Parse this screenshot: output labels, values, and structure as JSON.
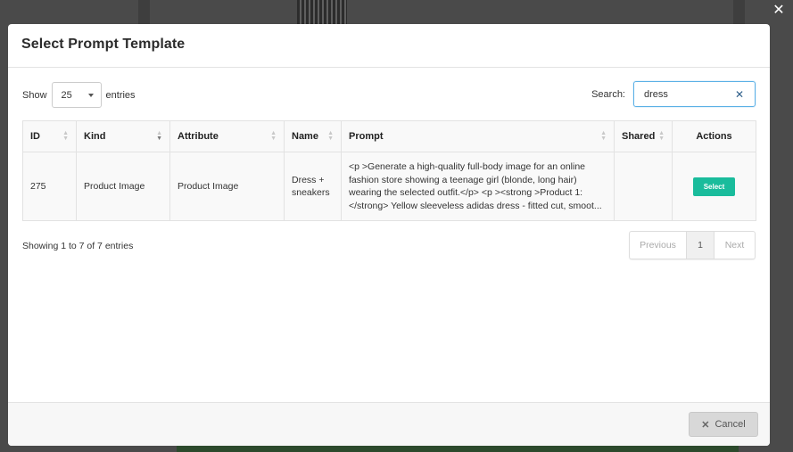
{
  "modal": {
    "title": "Select Prompt Template",
    "close_glyph": "✕"
  },
  "length": {
    "show_label": "Show",
    "value": "25",
    "entries_label": "entries"
  },
  "search": {
    "label": "Search:",
    "value": "dress",
    "clear_glyph": "✕"
  },
  "table": {
    "columns": [
      "ID",
      "Kind",
      "Attribute",
      "Name",
      "Prompt",
      "Shared",
      "Actions"
    ],
    "rows": [
      {
        "id": "275",
        "kind": "Product Image",
        "attribute": "Product Image",
        "name": "Dress + sneakers",
        "prompt_lines": [
          "<p >Generate a high-quality full-body image for an online",
          "fashion store showing a teenage girl (blonde, long hair)",
          "wearing the selected outfit.</p> <p ><strong >Product 1:",
          "</strong> Yellow sleeveless adidas dress - fitted cut, smoot..."
        ],
        "shared": "",
        "action_label": "Select"
      }
    ]
  },
  "info": "Showing 1 to 7 of 7 entries",
  "pager": {
    "previous": "Previous",
    "page": "1",
    "next": "Next"
  },
  "footer": {
    "cancel_label": "Cancel",
    "cancel_glyph": "✕"
  },
  "colors": {
    "accent": "#1abc9c",
    "search_border": "#5bb0e6"
  }
}
